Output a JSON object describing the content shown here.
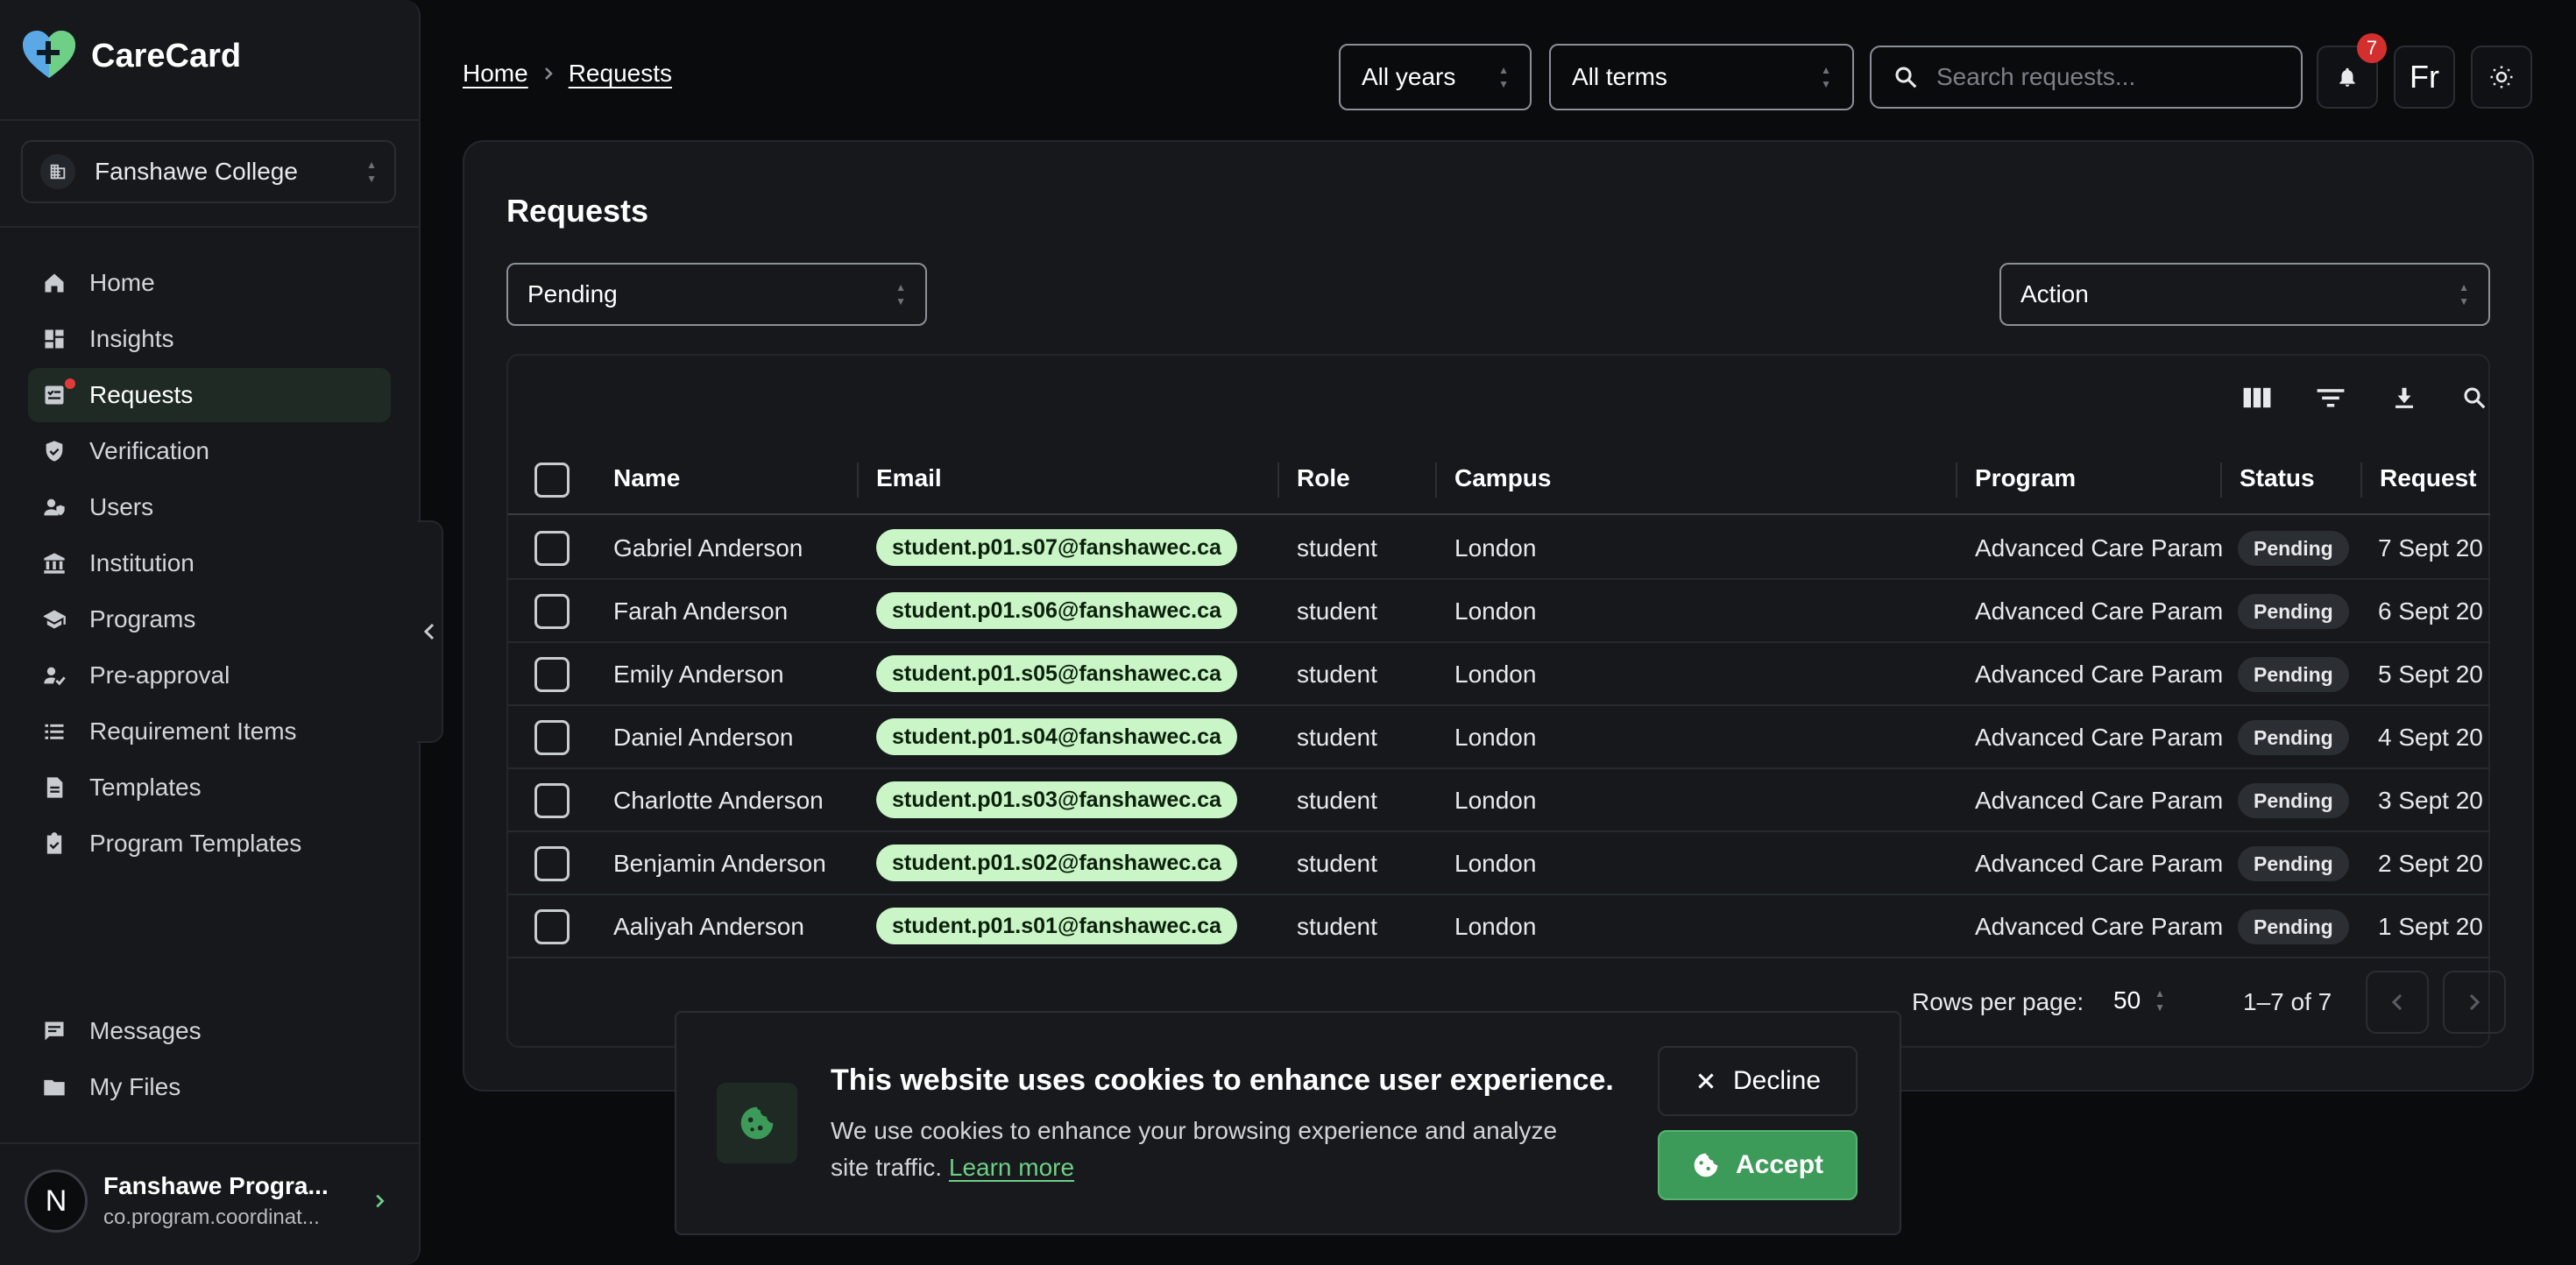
{
  "app": {
    "name": "CareCard"
  },
  "institution": {
    "name": "Fanshawe College"
  },
  "nav": [
    {
      "label": "Home",
      "icon": "home-icon"
    },
    {
      "label": "Insights",
      "icon": "dashboard-icon"
    },
    {
      "label": "Requests",
      "icon": "requests-icon",
      "active": true,
      "has_dot": true
    },
    {
      "label": "Verification",
      "icon": "shield-check-icon"
    },
    {
      "label": "Users",
      "icon": "user-shield-icon"
    },
    {
      "label": "Institution",
      "icon": "bank-icon"
    },
    {
      "label": "Programs",
      "icon": "school-icon"
    },
    {
      "label": "Pre-approval",
      "icon": "person-check-icon"
    },
    {
      "label": "Requirement Items",
      "icon": "list-icon"
    },
    {
      "label": "Templates",
      "icon": "document-icon"
    },
    {
      "label": "Program Templates",
      "icon": "clipboard-check-icon"
    }
  ],
  "nav_bottom": [
    {
      "label": "Messages",
      "icon": "message-icon"
    },
    {
      "label": "My Files",
      "icon": "folder-icon"
    }
  ],
  "user": {
    "avatar_letter": "N",
    "name": "Fanshawe Progra...",
    "email": "co.program.coordinat..."
  },
  "breadcrumb": {
    "home": "Home",
    "current": "Requests"
  },
  "header": {
    "year_select": "All years",
    "term_select": "All terms",
    "search_placeholder": "Search requests...",
    "notification_count": "7",
    "language": "Fr"
  },
  "page": {
    "title": "Requests",
    "status_filter": "Pending",
    "action_select": "Action"
  },
  "table": {
    "columns": [
      "Name",
      "Email",
      "Role",
      "Campus",
      "Program",
      "Status",
      "Request"
    ],
    "rows": [
      {
        "name": "Gabriel Anderson",
        "email": "student.p01.s07@fanshawec.ca",
        "role": "student",
        "campus": "London",
        "program": "Advanced Care Param",
        "status": "Pending",
        "request": "7 Sept 20"
      },
      {
        "name": "Farah Anderson",
        "email": "student.p01.s06@fanshawec.ca",
        "role": "student",
        "campus": "London",
        "program": "Advanced Care Param",
        "status": "Pending",
        "request": "6 Sept 20"
      },
      {
        "name": "Emily Anderson",
        "email": "student.p01.s05@fanshawec.ca",
        "role": "student",
        "campus": "London",
        "program": "Advanced Care Param",
        "status": "Pending",
        "request": "5 Sept 20"
      },
      {
        "name": "Daniel Anderson",
        "email": "student.p01.s04@fanshawec.ca",
        "role": "student",
        "campus": "London",
        "program": "Advanced Care Param",
        "status": "Pending",
        "request": "4 Sept 20"
      },
      {
        "name": "Charlotte Anderson",
        "email": "student.p01.s03@fanshawec.ca",
        "role": "student",
        "campus": "London",
        "program": "Advanced Care Param",
        "status": "Pending",
        "request": "3 Sept 20"
      },
      {
        "name": "Benjamin Anderson",
        "email": "student.p01.s02@fanshawec.ca",
        "role": "student",
        "campus": "London",
        "program": "Advanced Care Param",
        "status": "Pending",
        "request": "2 Sept 20"
      },
      {
        "name": "Aaliyah Anderson",
        "email": "student.p01.s01@fanshawec.ca",
        "role": "student",
        "campus": "London",
        "program": "Advanced Care Param",
        "status": "Pending",
        "request": "1 Sept 20"
      }
    ]
  },
  "pagination": {
    "rows_label": "Rows per page:",
    "rows_value": "50",
    "range": "1–7 of 7"
  },
  "cookie": {
    "title": "This website uses cookies to enhance user experience.",
    "text": "We use cookies to enhance your browsing experience and analyze site traffic.",
    "link": "Learn more",
    "decline": "Decline",
    "accept": "Accept"
  },
  "colors": {
    "accent": "#3d9b5a",
    "email_chip": "#c9f5c7",
    "badge": "#d32f2f"
  }
}
